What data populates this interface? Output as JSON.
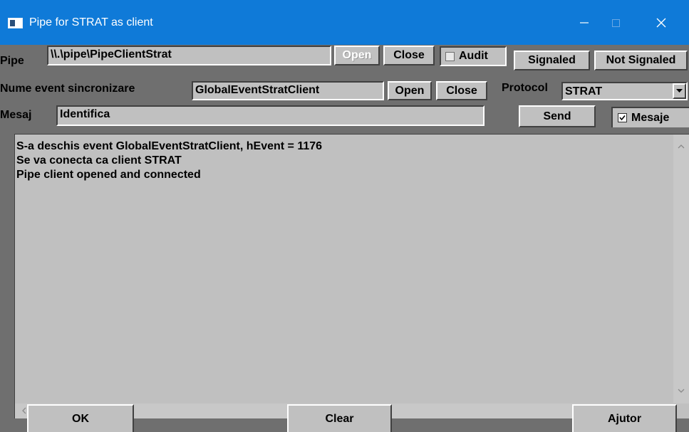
{
  "window": {
    "title": "Pipe for STRAT as client",
    "icons": {
      "app": "app-icon",
      "minimize": "minimize-icon",
      "maximize": "maximize-icon",
      "close": "close-icon"
    }
  },
  "pipe": {
    "label": "Pipe",
    "value": "\\\\.\\pipe\\PipeClientStrat",
    "open_label": "Open",
    "close_label": "Close",
    "audit_label": "Audit",
    "audit_checked": false,
    "signaled_label": "Signaled",
    "not_signaled_label": "Not Signaled"
  },
  "event": {
    "label": "Nume event sincronizare",
    "value": "GlobalEventStratClient",
    "open_label": "Open",
    "close_label": "Close",
    "protocol_label": "Protocol",
    "protocol_value": "STRAT"
  },
  "message": {
    "label": "Mesaj",
    "value": "Identifica",
    "send_label": "Send",
    "mesaje_label": "Mesaje",
    "mesaje_checked": true
  },
  "log": {
    "lines": [
      "S-a deschis event GlobalEventStratClient, hEvent = 1176",
      "Se va conecta ca client STRAT",
      "Pipe client opened and connected"
    ]
  },
  "buttons": {
    "ok": "OK",
    "clear": "Clear",
    "help": "Ajutor"
  },
  "colors": {
    "titlebar": "#0f7ad8",
    "dialog_bg": "#6f6f6f",
    "control_bg": "#c0c0c0"
  }
}
